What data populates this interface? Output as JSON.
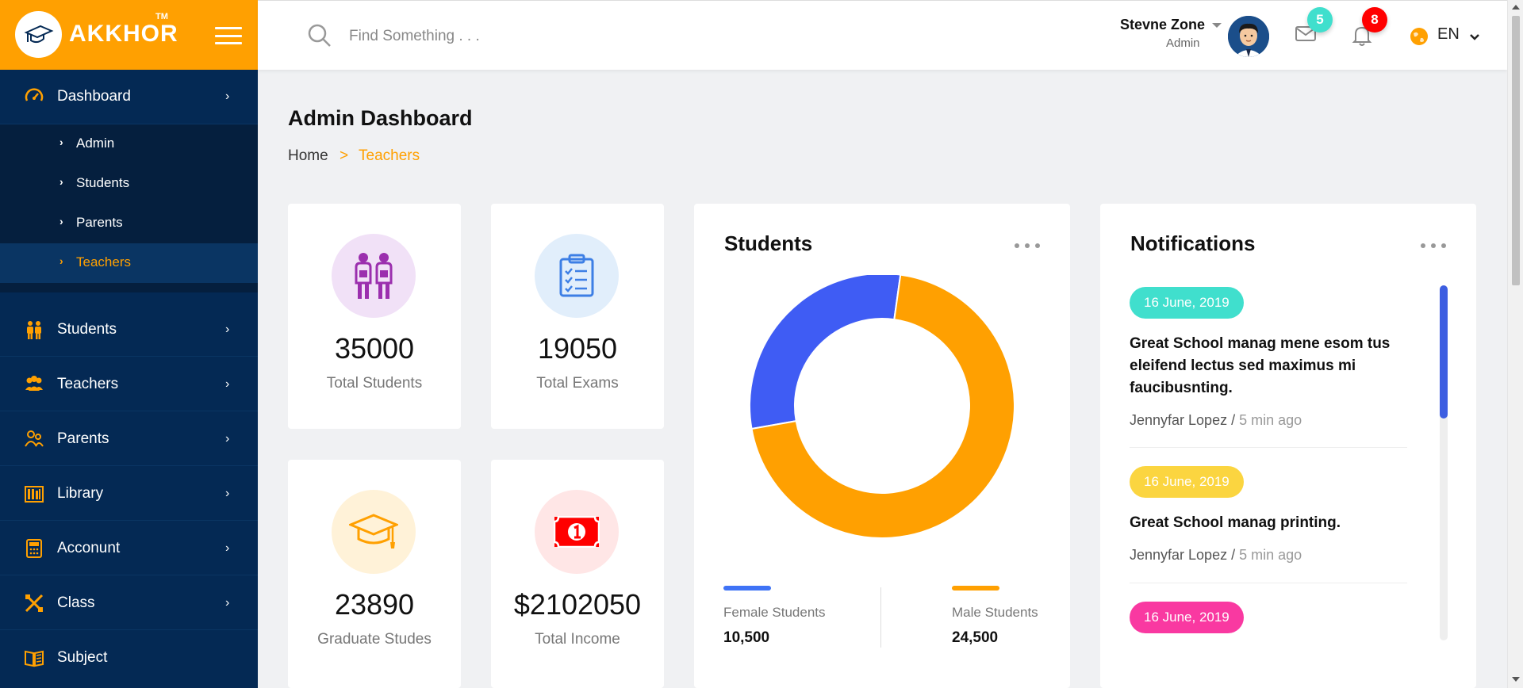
{
  "brand": {
    "name": "AKKHOR",
    "tm": "TM"
  },
  "sidebar": {
    "items": [
      {
        "label": "Dashboard",
        "icon": "dashboard-icon"
      },
      {
        "label": "Students",
        "icon": "students-icon"
      },
      {
        "label": "Teachers",
        "icon": "teachers-icon"
      },
      {
        "label": "Parents",
        "icon": "parents-icon"
      },
      {
        "label": "Library",
        "icon": "library-icon"
      },
      {
        "label": "Acconunt",
        "icon": "account-icon"
      },
      {
        "label": "Class",
        "icon": "class-icon"
      },
      {
        "label": "Subject",
        "icon": "subject-icon"
      }
    ],
    "dashboard_sub": [
      {
        "label": "Admin"
      },
      {
        "label": "Students"
      },
      {
        "label": "Parents"
      },
      {
        "label": "Teachers",
        "active": true
      }
    ]
  },
  "header": {
    "search_placeholder": "Find Something . . .",
    "user_name": "Stevne Zone",
    "user_role": "Admin",
    "messages_count": "5",
    "notifications_count": "8",
    "language": "EN"
  },
  "page": {
    "title": "Admin Dashboard",
    "breadcrumb": {
      "home": "Home",
      "separator": ">",
      "current": "Teachers"
    }
  },
  "stats": [
    {
      "value": "35000",
      "label": "Total Students",
      "icon": "students-pair-icon"
    },
    {
      "value": "19050",
      "label": "Total Exams",
      "icon": "clipboard-checklist-icon"
    },
    {
      "value": "23890",
      "label": "Graduate Studes",
      "icon": "graduation-cap-icon"
    },
    {
      "value": "$2102050",
      "label": "Total Income",
      "icon": "money-bill-icon"
    }
  ],
  "students_card": {
    "title": "Students",
    "female_label": "Female Students",
    "female_value": "10,500",
    "male_label": "Male Students",
    "male_value": "24,500"
  },
  "chart_data": {
    "type": "pie",
    "categories": [
      "Female Students",
      "Male Students"
    ],
    "values": [
      10500,
      24500
    ],
    "colors": [
      "#3f5cf4",
      "#ffa001"
    ],
    "title": "Students",
    "donut": true
  },
  "notifications": {
    "title": "Notifications",
    "items": [
      {
        "date": "16 June, 2019",
        "color": "#40dfcd",
        "text": "Great School manag mene esom tus eleifend lectus sed maximus mi faucibusnting.",
        "author": "Jennyfar Lopez /",
        "ago": "5 min ago"
      },
      {
        "date": "16 June, 2019",
        "color": "#fbd540",
        "text": "Great School manag printing.",
        "author": "Jennyfar Lopez /",
        "ago": "5 min ago"
      },
      {
        "date": "16 June, 2019",
        "color": "#f939a1",
        "text": "",
        "author": "",
        "ago": ""
      }
    ]
  },
  "colors": {
    "accent": "#ffa001",
    "sidebar": "#042954",
    "female": "#3f5cf4",
    "male": "#ffa001"
  }
}
